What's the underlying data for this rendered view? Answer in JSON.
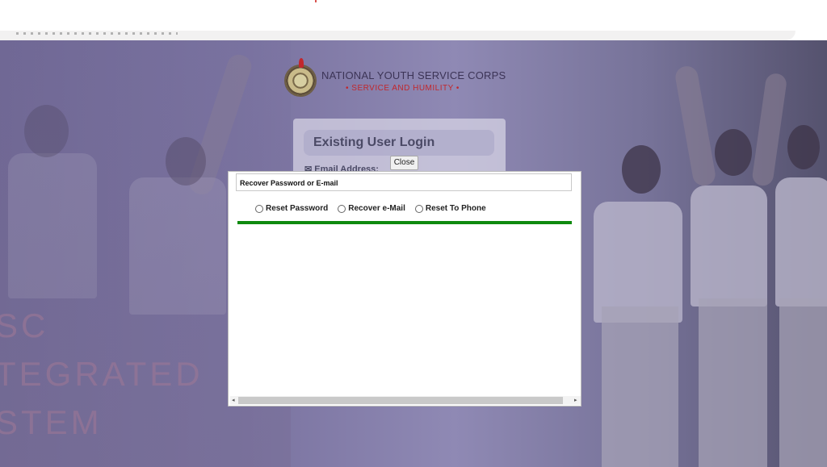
{
  "colors": {
    "brand_red": "#c1272d",
    "progress_green": "#0f8a0f",
    "hero_purple": "#7a73a0"
  },
  "logo": {
    "org_name": "NATIONAL YOUTH SERVICE CORPS",
    "motto": "• SERVICE AND HUMILITY •",
    "icon": "nysc-seal-icon"
  },
  "login": {
    "title": "Existing User Login",
    "email_label": "Email Address:",
    "email_icon": "envelope-icon"
  },
  "tagline": {
    "line1": "SC",
    "line2": "TEGRATED",
    "line3": "STEM"
  },
  "dialog": {
    "close_label": "Close",
    "title": "Recover Password or E-mail",
    "options": [
      {
        "label": "Reset Password",
        "selected": false
      },
      {
        "label": "Recover e-Mail",
        "selected": false
      },
      {
        "label": "Reset To Phone",
        "selected": false
      }
    ],
    "scroll_left": "◂",
    "scroll_right": "▸"
  }
}
